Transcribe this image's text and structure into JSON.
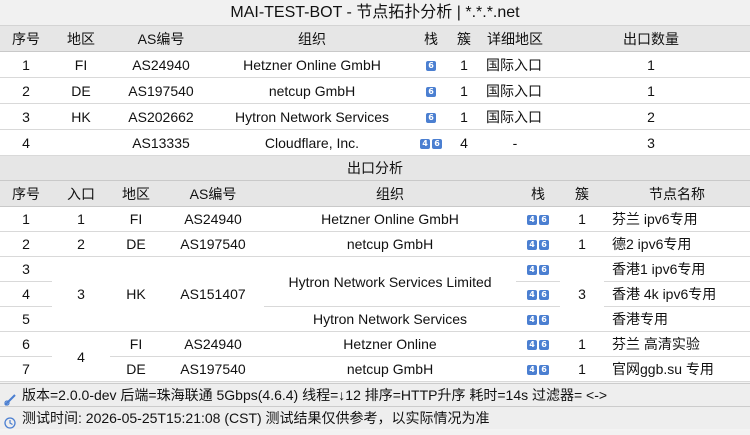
{
  "title": "MAI-TEST-BOT - 节点拓扑分析 | *.*.*.net",
  "topology": {
    "headers": [
      "序号",
      "地区",
      "AS编号",
      "组织",
      "栈",
      "簇",
      "详细地区",
      "出口数量"
    ],
    "rows": [
      {
        "idx": "1",
        "region": "FI",
        "as": "AS24940",
        "org": "Hetzner Online GmbH",
        "stack": [
          "6"
        ],
        "cluster": "1",
        "detail": "国际入口",
        "exits": "1"
      },
      {
        "idx": "2",
        "region": "DE",
        "as": "AS197540",
        "org": "netcup GmbH",
        "stack": [
          "6"
        ],
        "cluster": "1",
        "detail": "国际入口",
        "exits": "1"
      },
      {
        "idx": "3",
        "region": "HK",
        "as": "AS202662",
        "org": "Hytron Network Services",
        "stack": [
          "6"
        ],
        "cluster": "1",
        "detail": "国际入口",
        "exits": "2"
      },
      {
        "idx": "4",
        "region": "",
        "as": "AS13335",
        "org": "Cloudflare, Inc.",
        "stack": [
          "4",
          "6"
        ],
        "cluster": "4",
        "detail": "-",
        "exits": "3"
      }
    ]
  },
  "exit_section_title": "出口分析",
  "exit": {
    "headers": [
      "序号",
      "入口",
      "地区",
      "AS编号",
      "组织",
      "栈",
      "簇",
      "节点名称"
    ],
    "rows": [
      {
        "idx": "1",
        "entry": "1",
        "region": "FI",
        "as": "AS24940",
        "org": "Hetzner Online GmbH",
        "stack": [
          "4",
          "6"
        ],
        "cluster": "1",
        "name": "芬兰 ipv6专用"
      },
      {
        "idx": "2",
        "entry": "2",
        "region": "DE",
        "as": "AS197540",
        "org": "netcup GmbH",
        "stack": [
          "4",
          "6"
        ],
        "cluster": "1",
        "name": "德2 ipv6专用"
      },
      {
        "idx": "3",
        "entry": "3",
        "region": "HK",
        "as": "AS151407",
        "org": "Hytron Network Services Limited",
        "stack": [
          "4",
          "6"
        ],
        "cluster": "3",
        "name": "香港1 ipv6专用"
      },
      {
        "idx": "4",
        "stack": [
          "4",
          "6"
        ],
        "name": "香港 4k ipv6专用"
      },
      {
        "idx": "5",
        "org": "Hytron Network Services",
        "stack": [
          "4",
          "6"
        ],
        "name": "香港专用"
      },
      {
        "idx": "6",
        "entry": "4",
        "region": "FI",
        "as": "AS24940",
        "org": "Hetzner Online",
        "stack": [
          "4",
          "6"
        ],
        "cluster": "1",
        "name": "芬兰 高清实验"
      },
      {
        "idx": "7",
        "region": "DE",
        "as": "AS197540",
        "org": "netcup GmbH",
        "stack": [
          "4",
          "6"
        ],
        "cluster": "1",
        "name": "官网ggb.su 专用"
      }
    ]
  },
  "status": {
    "line1": "版本=2.0.0-dev  后端=珠海联通 5Gbps(4.6.4)  线程=↓12  排序=HTTP升序  耗时=14s   过滤器= <->",
    "line2": "测试时间: 2026-05-25T15:21:08 (CST)  测试结果仅供参考，以实际情况为准"
  },
  "icons": [
    "settings-icon",
    "clock-icon"
  ],
  "colors": {
    "badge": "#4b7fd1",
    "header_bg": "#e6e6e6",
    "row_bg": "#ffffff"
  }
}
